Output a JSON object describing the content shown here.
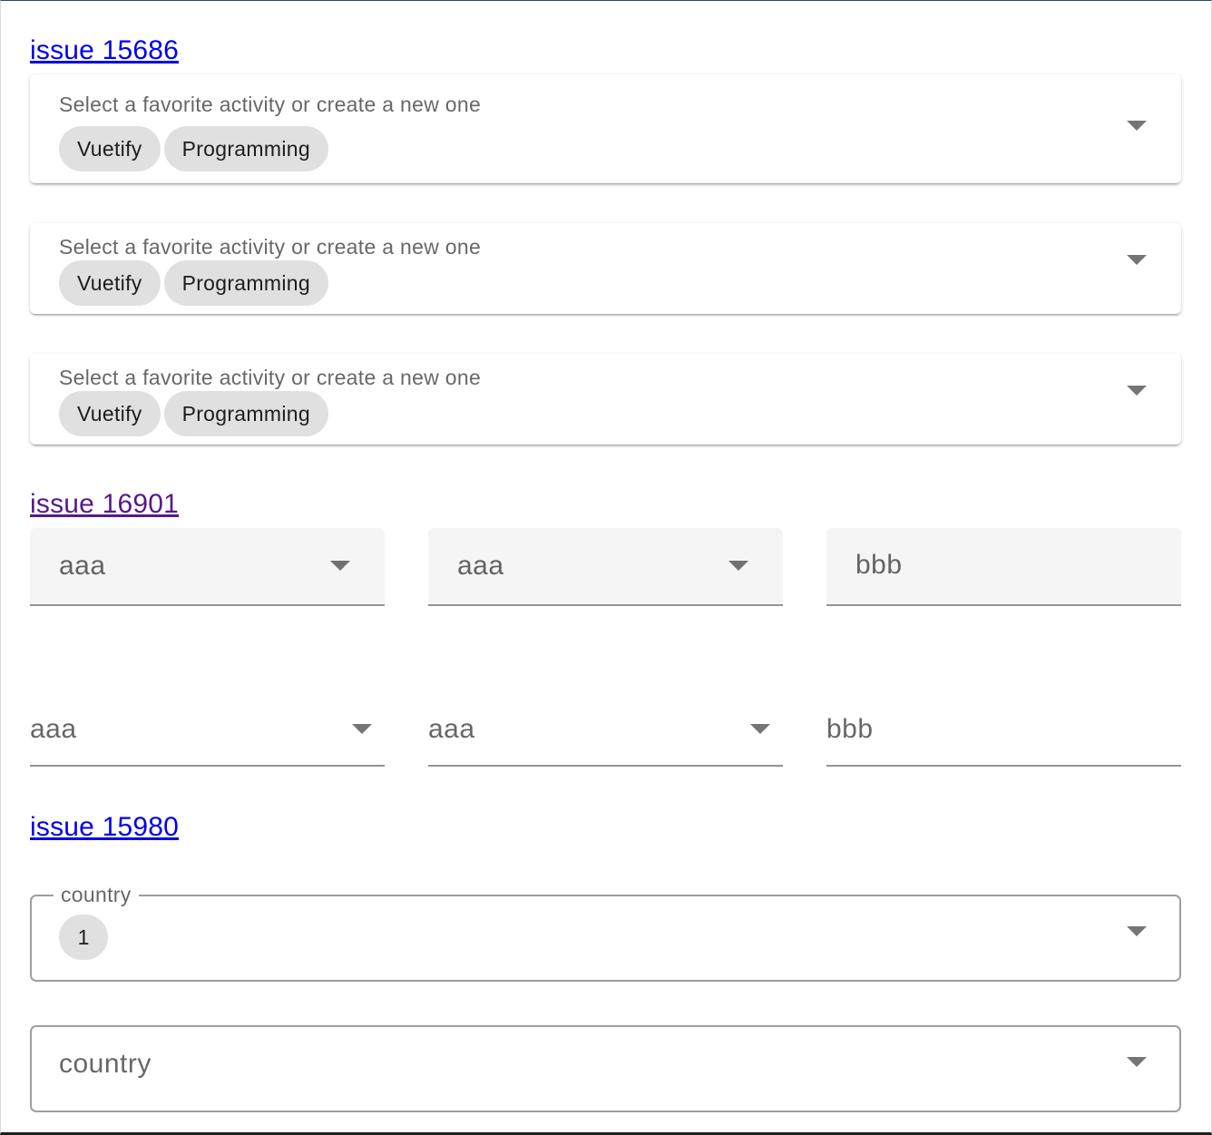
{
  "sections": [
    {
      "link": "issue 15686",
      "fields": [
        {
          "label": "Select a favorite activity or create a new one",
          "chips": [
            "Vuetify",
            "Programming"
          ]
        },
        {
          "label": "Select a favorite activity or create a new one",
          "chips": [
            "Vuetify",
            "Programming"
          ]
        },
        {
          "label": "Select a favorite activity or create a new one",
          "chips": [
            "Vuetify",
            "Programming"
          ]
        }
      ]
    },
    {
      "link": "issue 16901",
      "filled_row": [
        "aaa",
        "aaa",
        "bbb"
      ],
      "underlined_row": [
        "aaa",
        "aaa",
        "bbb"
      ]
    },
    {
      "link": "issue 15980",
      "outlined_fields": [
        {
          "legend": "country",
          "chip": "1"
        },
        {
          "placeholder": "country"
        }
      ]
    }
  ],
  "colors": {
    "link_unvisited": "#0000ee",
    "link_visited": "#551a8b",
    "chip_bg": "#e0e0e0",
    "filled_bg": "#f5f5f5"
  }
}
